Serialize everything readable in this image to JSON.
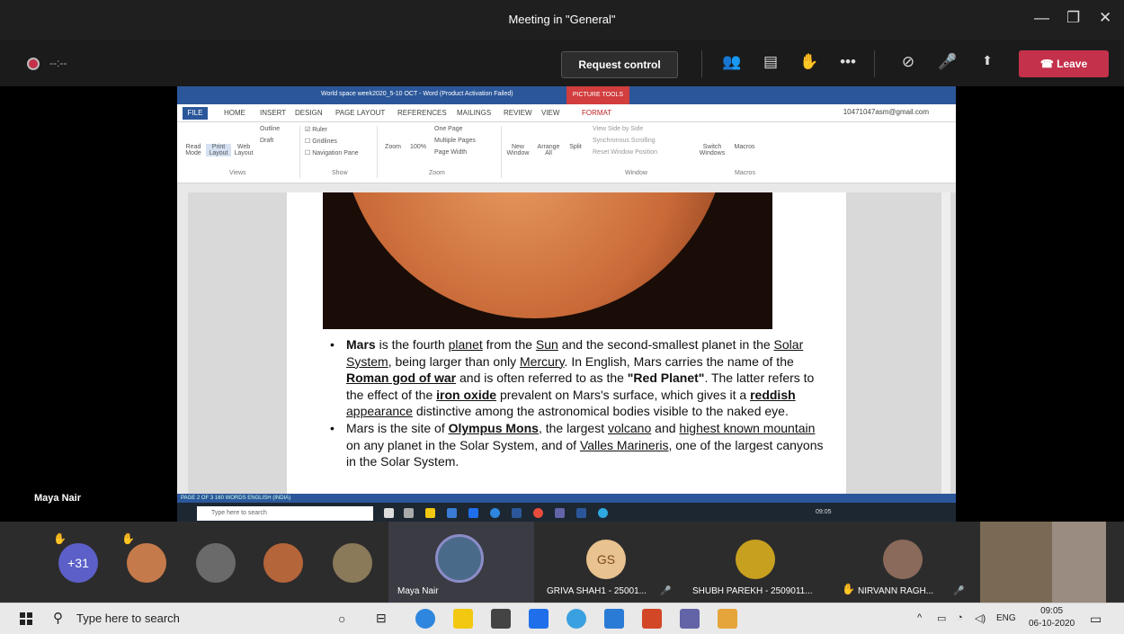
{
  "window": {
    "title": "Meeting in \"General\"",
    "min_glyph": "—",
    "max_glyph": "❐",
    "close_glyph": "✕"
  },
  "meeting_bar": {
    "timer": "--:--",
    "request_control": "Request control",
    "leave": "Leave",
    "icons": [
      "people-icon",
      "chat-icon",
      "raise-hand-icon",
      "more-icon",
      "video-off-icon",
      "mic-off-icon",
      "share-icon"
    ]
  },
  "word": {
    "title": "World space week2020_5-10 OCT - Word (Product Activation Failed)",
    "picture_tools": "PICTURE TOOLS",
    "tabs": [
      "FILE",
      "HOME",
      "INSERT",
      "DESIGN",
      "PAGE LAYOUT",
      "REFERENCES",
      "MAILINGS",
      "REVIEW",
      "VIEW",
      "FORMAT"
    ],
    "account": "10471047asm@gmail.com",
    "ribbon": {
      "views": [
        "Read Mode",
        "Print Layout",
        "Web Layout"
      ],
      "outline": "Outline",
      "draft": "Draft",
      "ruler": "Ruler",
      "gridlines": "Gridlines",
      "navigation": "Navigation Pane",
      "zoom": "Zoom",
      "zoom100": "100%",
      "one_page": "One Page",
      "multiple": "Multiple Pages",
      "page_width": "Page Width",
      "new_window": "New Window",
      "arrange_all": "Arrange All",
      "split": "Split",
      "side_by_side": "View Side by Side",
      "sync_scroll": "Synchronous Scrolling",
      "reset_pos": "Reset Window Position",
      "switch": "Switch Windows",
      "macros": "Macros",
      "groups": [
        "Views",
        "Show",
        "Zoom",
        "Window",
        "Macros"
      ]
    },
    "bullets": [
      {
        "parts": [
          "Mars",
          " is the fourth ",
          "planet",
          " from the ",
          "Sun",
          " and the second-smallest planet in the ",
          "Solar System",
          ", being larger than only ",
          "Mercury",
          ". In English, Mars carries the name of the ",
          "Roman god of war",
          " and is often referred to as the ",
          "\"Red Planet\"",
          ". The latter refers to the effect of the ",
          "iron oxide",
          " prevalent on Mars's surface, which gives it a ",
          "reddish",
          " ",
          "appearance",
          " distinctive among the astronomical bodies visible to the naked eye."
        ]
      },
      {
        "parts": [
          "Mars is the site of ",
          "Olympus Mons",
          ", the largest ",
          "volcano",
          " and ",
          "highest known mountain",
          " on any planet in the Solar System, and of ",
          "Valles Marineris",
          ", one of the largest canyons in the Solar System."
        ]
      }
    ],
    "status": "PAGE 2 OF 3   160 WORDS   ENGLISH (INDIA)",
    "inner_search": "Type here to search",
    "inner_clock": "09:05"
  },
  "speaker_label": "Maya Nair",
  "roster": {
    "overflow": "+31",
    "participants": [
      {
        "name": "Maya Nair"
      },
      {
        "name": "GRIVA SHAH1 - 25001...",
        "initials": "GS"
      },
      {
        "name": "SHUBH PAREKH - 2509011..."
      },
      {
        "name": "NIRVANN RAGH..."
      }
    ]
  },
  "taskbar": {
    "search": "Type here to search",
    "lang": "ENG",
    "time": "09:05",
    "date": "06-10-2020"
  }
}
